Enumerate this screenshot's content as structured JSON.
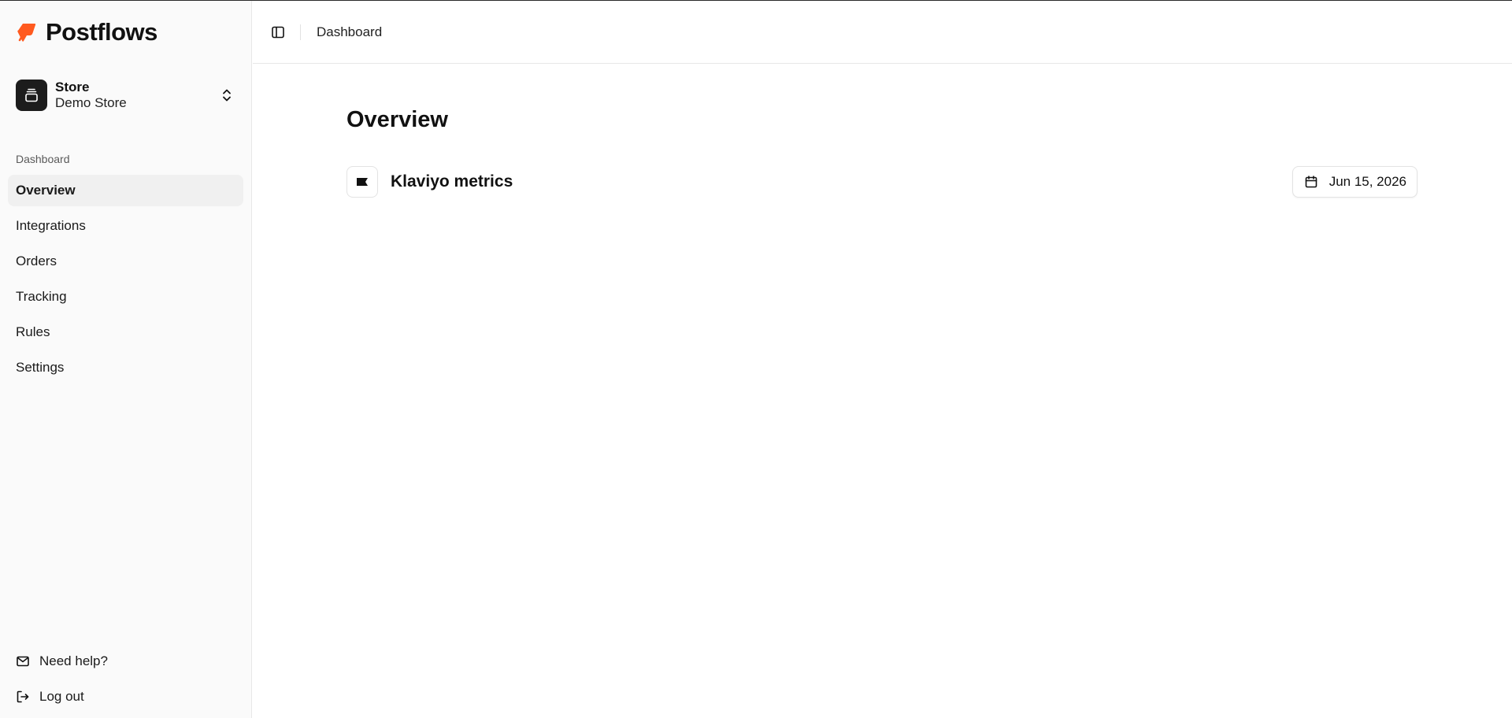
{
  "brand": {
    "name": "Postflows",
    "accent": "#ff5a1f"
  },
  "store": {
    "label": "Store",
    "name": "Demo Store"
  },
  "sidebar": {
    "section_label": "Dashboard",
    "items": [
      {
        "label": "Overview",
        "active": true
      },
      {
        "label": "Integrations"
      },
      {
        "label": "Orders"
      },
      {
        "label": "Tracking"
      },
      {
        "label": "Rules"
      },
      {
        "label": "Settings"
      }
    ],
    "footer": [
      {
        "label": "Need help?",
        "icon": "mail-icon"
      },
      {
        "label": "Log out",
        "icon": "log-out-icon"
      }
    ]
  },
  "header": {
    "breadcrumb": "Dashboard"
  },
  "main": {
    "title": "Overview",
    "metrics": {
      "title": "Klaviyo metrics",
      "icon": "flag-icon",
      "date": "Jun 15, 2026"
    }
  }
}
